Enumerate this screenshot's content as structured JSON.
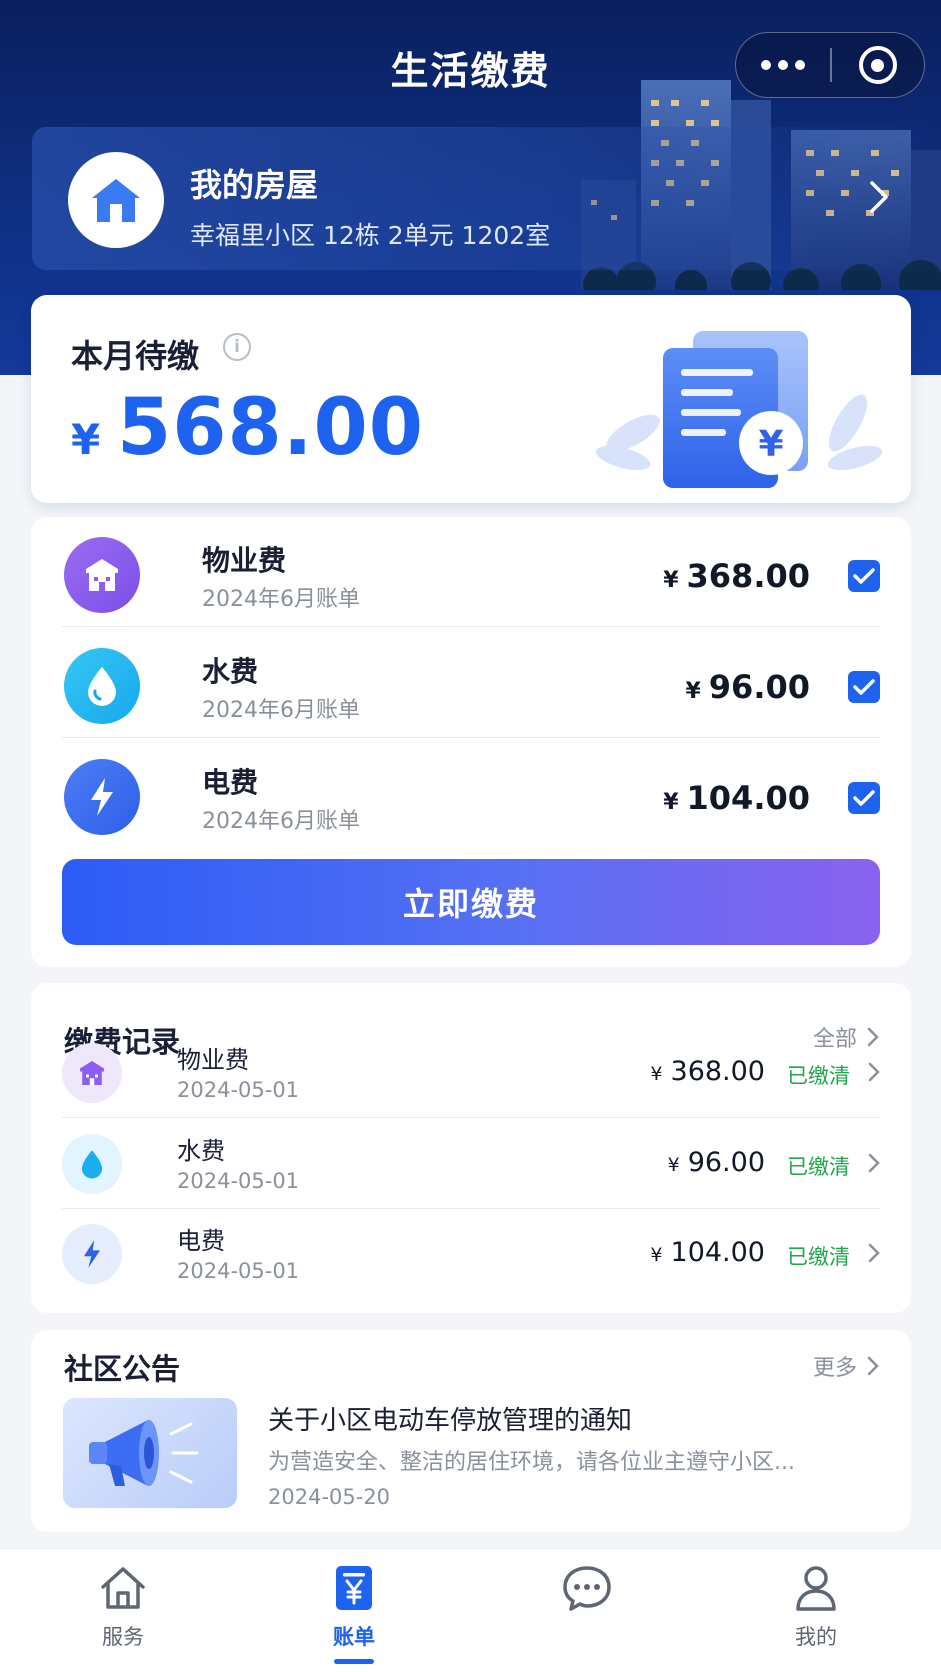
{
  "header": {
    "title": "生活缴费",
    "capsule": {
      "more_icon": "more-dots-icon",
      "close_icon": "target-close-icon"
    },
    "house": {
      "title": "我的房屋",
      "address": "幸福里小区 12栋 2单元 1202室",
      "icon": "house-icon"
    }
  },
  "pending": {
    "label": "本月待缴",
    "currency": "¥",
    "amount": "568.00",
    "info_icon": "info-icon"
  },
  "bills": {
    "items": [
      {
        "name": "物业费",
        "period": "2024年6月账单",
        "currency": "¥",
        "amount": "368.00",
        "checked": true,
        "icon": "building-icon"
      },
      {
        "name": "水费",
        "period": "2024年6月账单",
        "currency": "¥",
        "amount": "96.00",
        "checked": true,
        "icon": "water-drop-icon"
      },
      {
        "name": "电费",
        "period": "2024年6月账单",
        "currency": "¥",
        "amount": "104.00",
        "checked": true,
        "icon": "lightning-icon"
      }
    ],
    "pay_button": "立即缴费"
  },
  "records": {
    "title": "缴费记录",
    "link": "全部",
    "items": [
      {
        "name": "物业费",
        "date": "2024-05-01",
        "currency": "¥",
        "amount": "368.00",
        "status": "已缴清"
      },
      {
        "name": "水费",
        "date": "2024-05-01",
        "currency": "¥",
        "amount": "96.00",
        "status": "已缴清"
      },
      {
        "name": "电费",
        "date": "2024-05-01",
        "currency": "¥",
        "amount": "104.00",
        "status": "已缴清"
      }
    ]
  },
  "notice": {
    "title": "社区公告",
    "link": "更多",
    "item": {
      "title": "关于小区电动车停放管理的通知",
      "description": "为营造安全、整洁的居住环境，请各位业主遵守小区...",
      "date": "2024-05-20"
    }
  },
  "tabbar": {
    "tabs": [
      {
        "label": "服务",
        "icon": "home-icon",
        "active": false
      },
      {
        "label": "账单",
        "icon": "bill-yen-icon",
        "active": true
      },
      {
        "label": "",
        "icon": "chat-bubble-icon",
        "active": false
      },
      {
        "label": "我的",
        "icon": "user-icon",
        "active": false
      }
    ]
  },
  "colors": {
    "accent": "#1e62f0",
    "header_bg": "#0f2f82",
    "paid_green": "#1fa64a",
    "property_purple": "#8b5cf6",
    "water_cyan": "#1ab0ee"
  }
}
